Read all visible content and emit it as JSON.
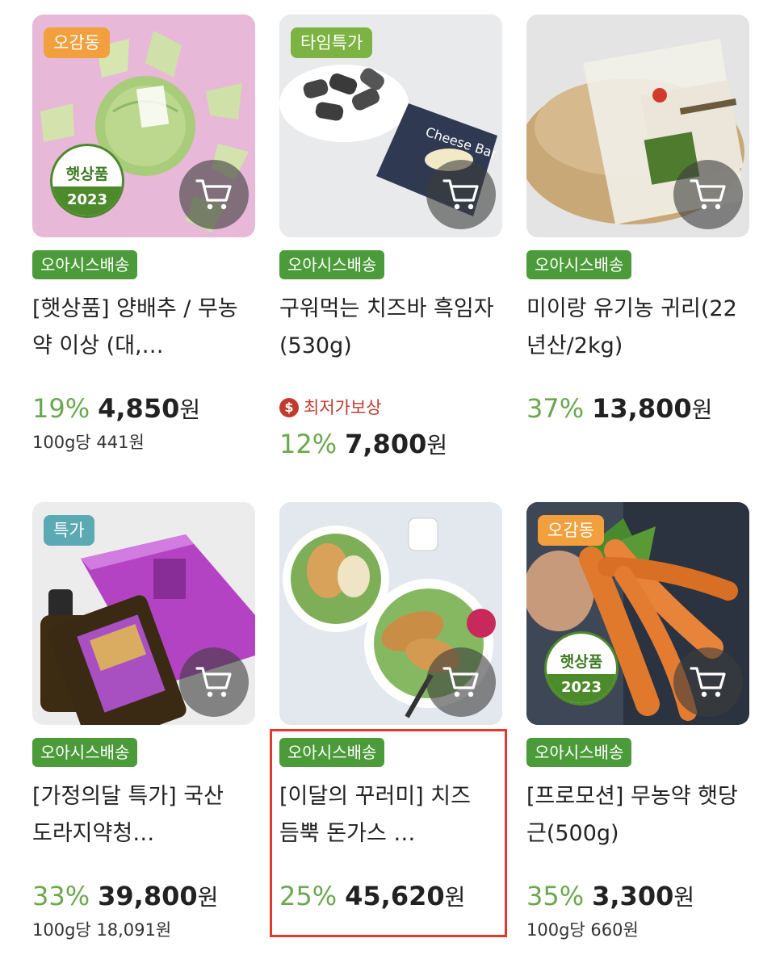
{
  "colors": {
    "discount_green": "#6aa84f",
    "delivery_badge": "#4c9b3a",
    "lowest_price_red": "#c23a2e",
    "highlight_border": "#e03a2a"
  },
  "products": [
    {
      "tag": "오감동",
      "tag_color": "#f2a03d",
      "seal": {
        "line1": "햇상품",
        "line2": "2023"
      },
      "delivery": "오아시스배송",
      "title": "[햇상품] 양배추 / 무농약 이상 (대,…",
      "discount": "19%",
      "price": "4,850",
      "currency": "원",
      "unit_price": "100g당 441원",
      "cart_icon": "cart-icon"
    },
    {
      "tag": "타임특가",
      "tag_color": "#7cb342",
      "delivery": "오아시스배송",
      "title": "구워먹는 치즈바 흑임자(530g)",
      "badge": {
        "icon": "dollar-icon",
        "icon_glyph": "$",
        "label": "최저가보상"
      },
      "discount": "12%",
      "price": "7,800",
      "currency": "원",
      "cart_icon": "cart-icon"
    },
    {
      "delivery": "오아시스배송",
      "title": "미이랑 유기농 귀리(22년산/2kg)",
      "discount": "37%",
      "price": "13,800",
      "currency": "원",
      "cart_icon": "cart-icon"
    },
    {
      "tag": "특가",
      "tag_color": "#5aa9b3",
      "delivery": "오아시스배송",
      "title": "[가정의달 특가] 국산 도라지약청…",
      "discount": "33%",
      "price": "39,800",
      "currency": "원",
      "unit_price": "100g당 18,091원",
      "cart_icon": "cart-icon"
    },
    {
      "delivery": "오아시스배송",
      "title": "[이달의 꾸러미] 치즈 듬뿍 돈가스 …",
      "discount": "25%",
      "price": "45,620",
      "currency": "원",
      "cart_icon": "cart-icon"
    },
    {
      "tag": "오감동",
      "tag_color": "#f2a03d",
      "seal": {
        "line1": "햇상품",
        "line2": "2023"
      },
      "delivery": "오아시스배송",
      "title": "[프로모션] 무농약 햇당근(500g)",
      "discount": "35%",
      "price": "3,300",
      "currency": "원",
      "unit_price": "100g당 660원",
      "cart_icon": "cart-icon"
    }
  ]
}
